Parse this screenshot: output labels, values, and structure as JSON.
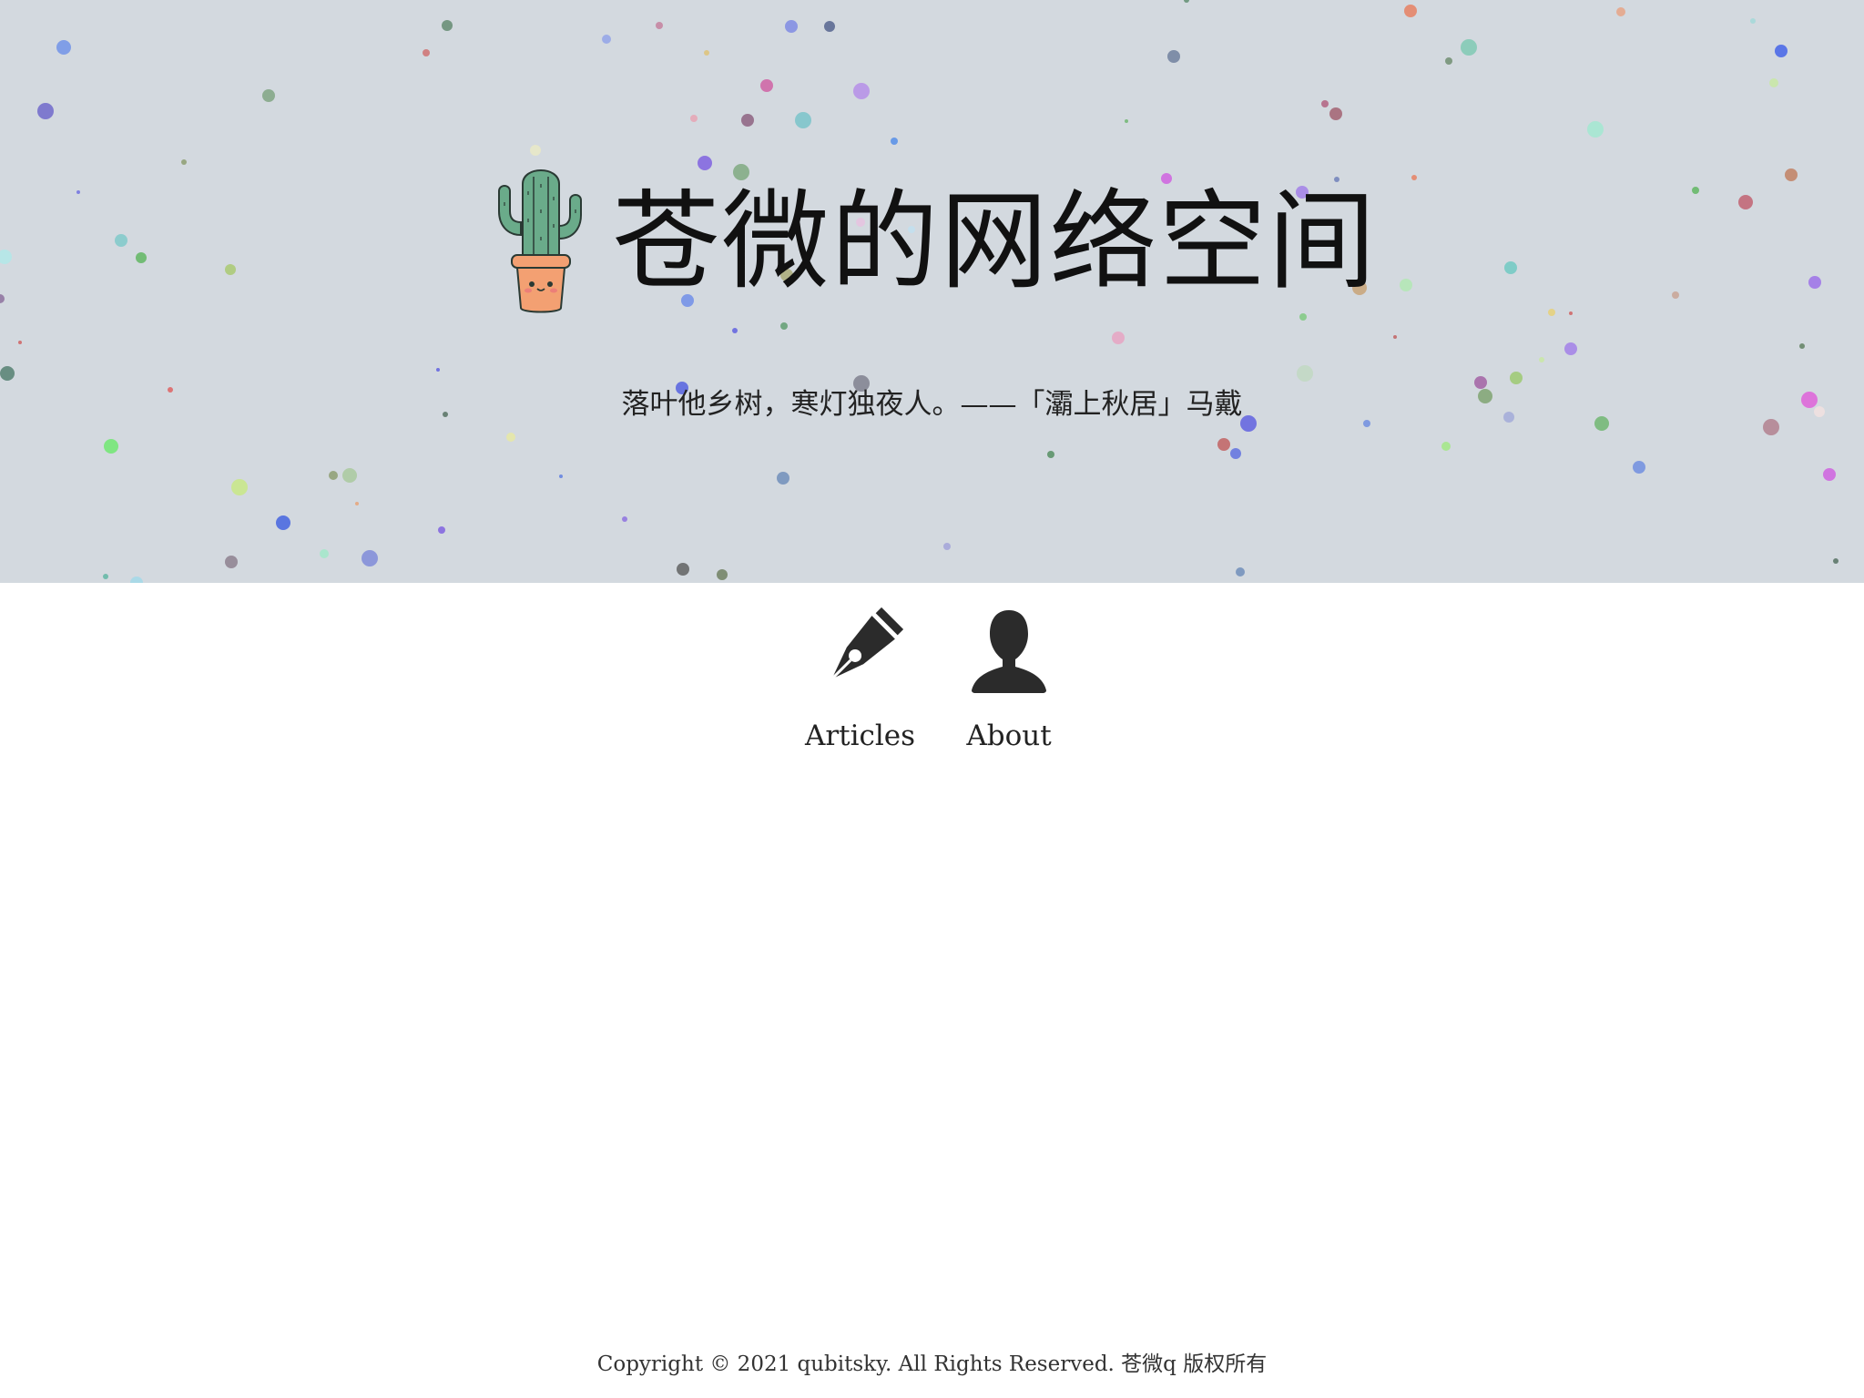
{
  "site": {
    "title": "苍微的网络空间",
    "motto": "落叶他乡树，寒灯独夜人。——「灞上秋居」马戴",
    "logo_icon": "cactus-in-pot-icon"
  },
  "nav": {
    "items": [
      {
        "label": "Articles",
        "icon": "fountain-pen-icon"
      },
      {
        "label": "About",
        "icon": "user-silhouette-icon"
      }
    ]
  },
  "footer": {
    "copyright": "Copyright © 2021 qubitsky. All Rights Reserved. 苍微q 版权所有"
  },
  "colors": {
    "hero_background": "#d3d9df",
    "page_background": "#ffffff",
    "text": "#222222"
  }
}
